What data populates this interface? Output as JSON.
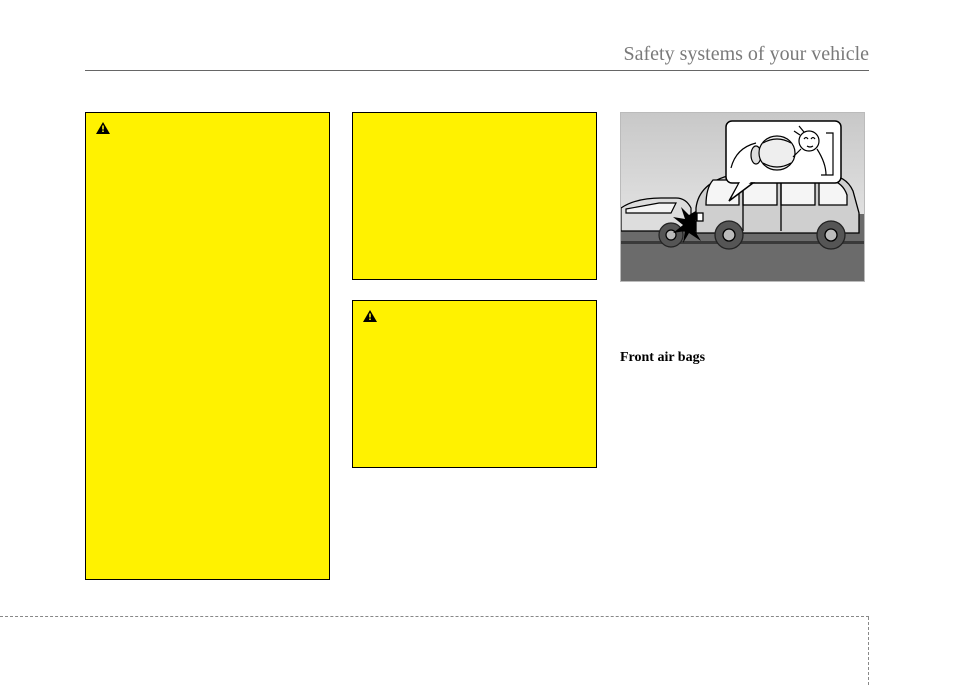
{
  "header": {
    "title": "Safety systems of your vehicle"
  },
  "boxes": {
    "warning1": {
      "hasIcon": true
    },
    "caution": {
      "hasIcon": false
    },
    "warning2": {
      "hasIcon": true
    }
  },
  "section": {
    "heading": "Front air bags"
  },
  "illustration": {
    "description": "Vehicle collision with airbag deployment callout"
  }
}
